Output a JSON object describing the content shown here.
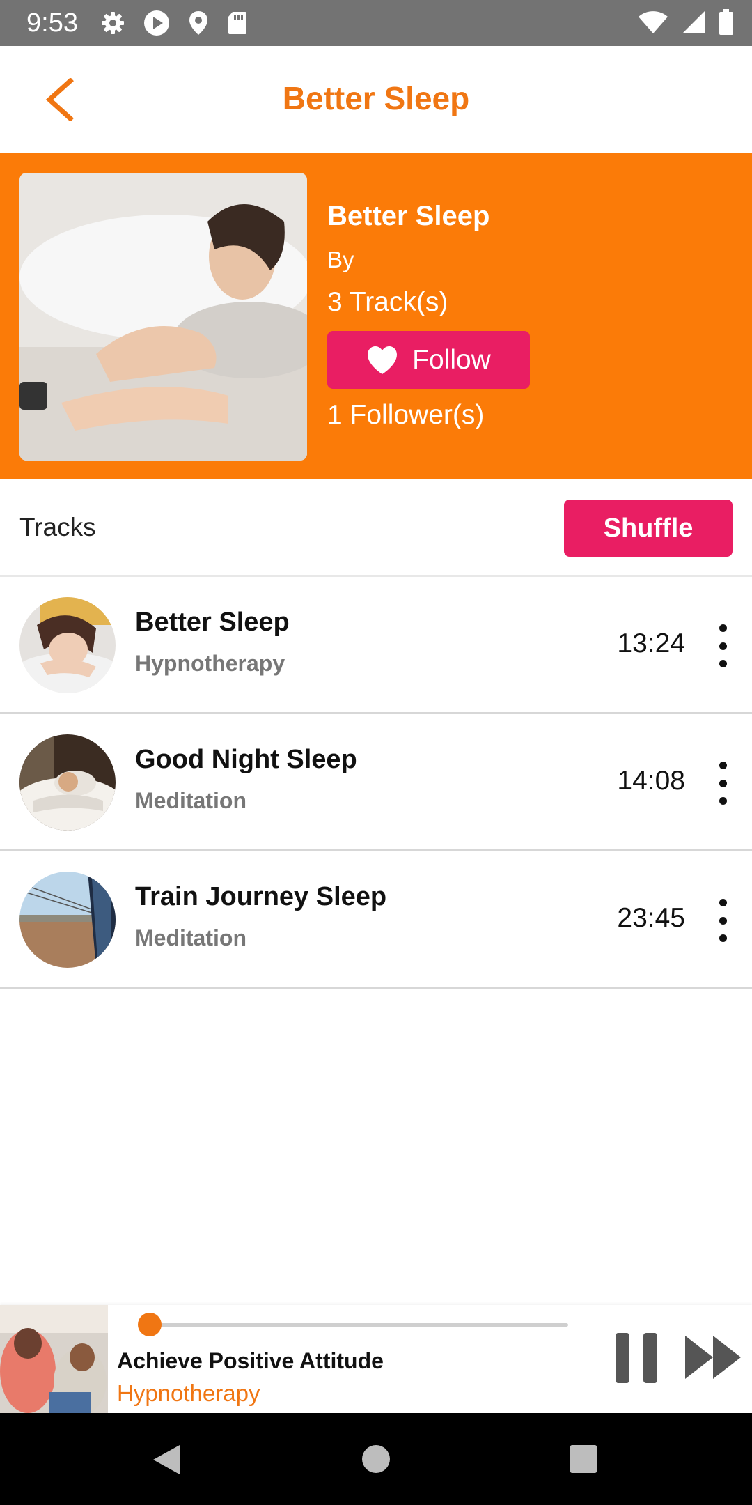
{
  "status_bar": {
    "time": "9:53",
    "left_icons": [
      "gear-icon",
      "play-icon",
      "location-pin-icon",
      "sd-card-icon"
    ],
    "right_icons": [
      "wifi-icon",
      "signal-icon",
      "battery-icon"
    ]
  },
  "app_bar": {
    "title": "Better Sleep",
    "back_icon": "chevron-left-icon"
  },
  "playlist": {
    "title": "Better Sleep",
    "by": "By",
    "tracks_count": "3 Track(s)",
    "follow_label": "Follow",
    "followers": "1 Follower(s)"
  },
  "tracks_header": {
    "label": "Tracks",
    "shuffle_label": "Shuffle"
  },
  "tracks": [
    {
      "title": "Better Sleep",
      "category": "Hypnotherapy",
      "duration": "13:24"
    },
    {
      "title": "Good Night Sleep",
      "category": "Meditation",
      "duration": "14:08"
    },
    {
      "title": "Train Journey Sleep",
      "category": "Meditation",
      "duration": "23:45"
    }
  ],
  "mini_player": {
    "title": "Achieve Positive Attitude",
    "category": "Hypnotherapy",
    "progress_fraction": 0.02
  },
  "colors": {
    "accent_orange": "#fb7b08",
    "title_orange": "#f07613",
    "button_pink": "#e91e63",
    "status_bar_gray": "#737373"
  }
}
